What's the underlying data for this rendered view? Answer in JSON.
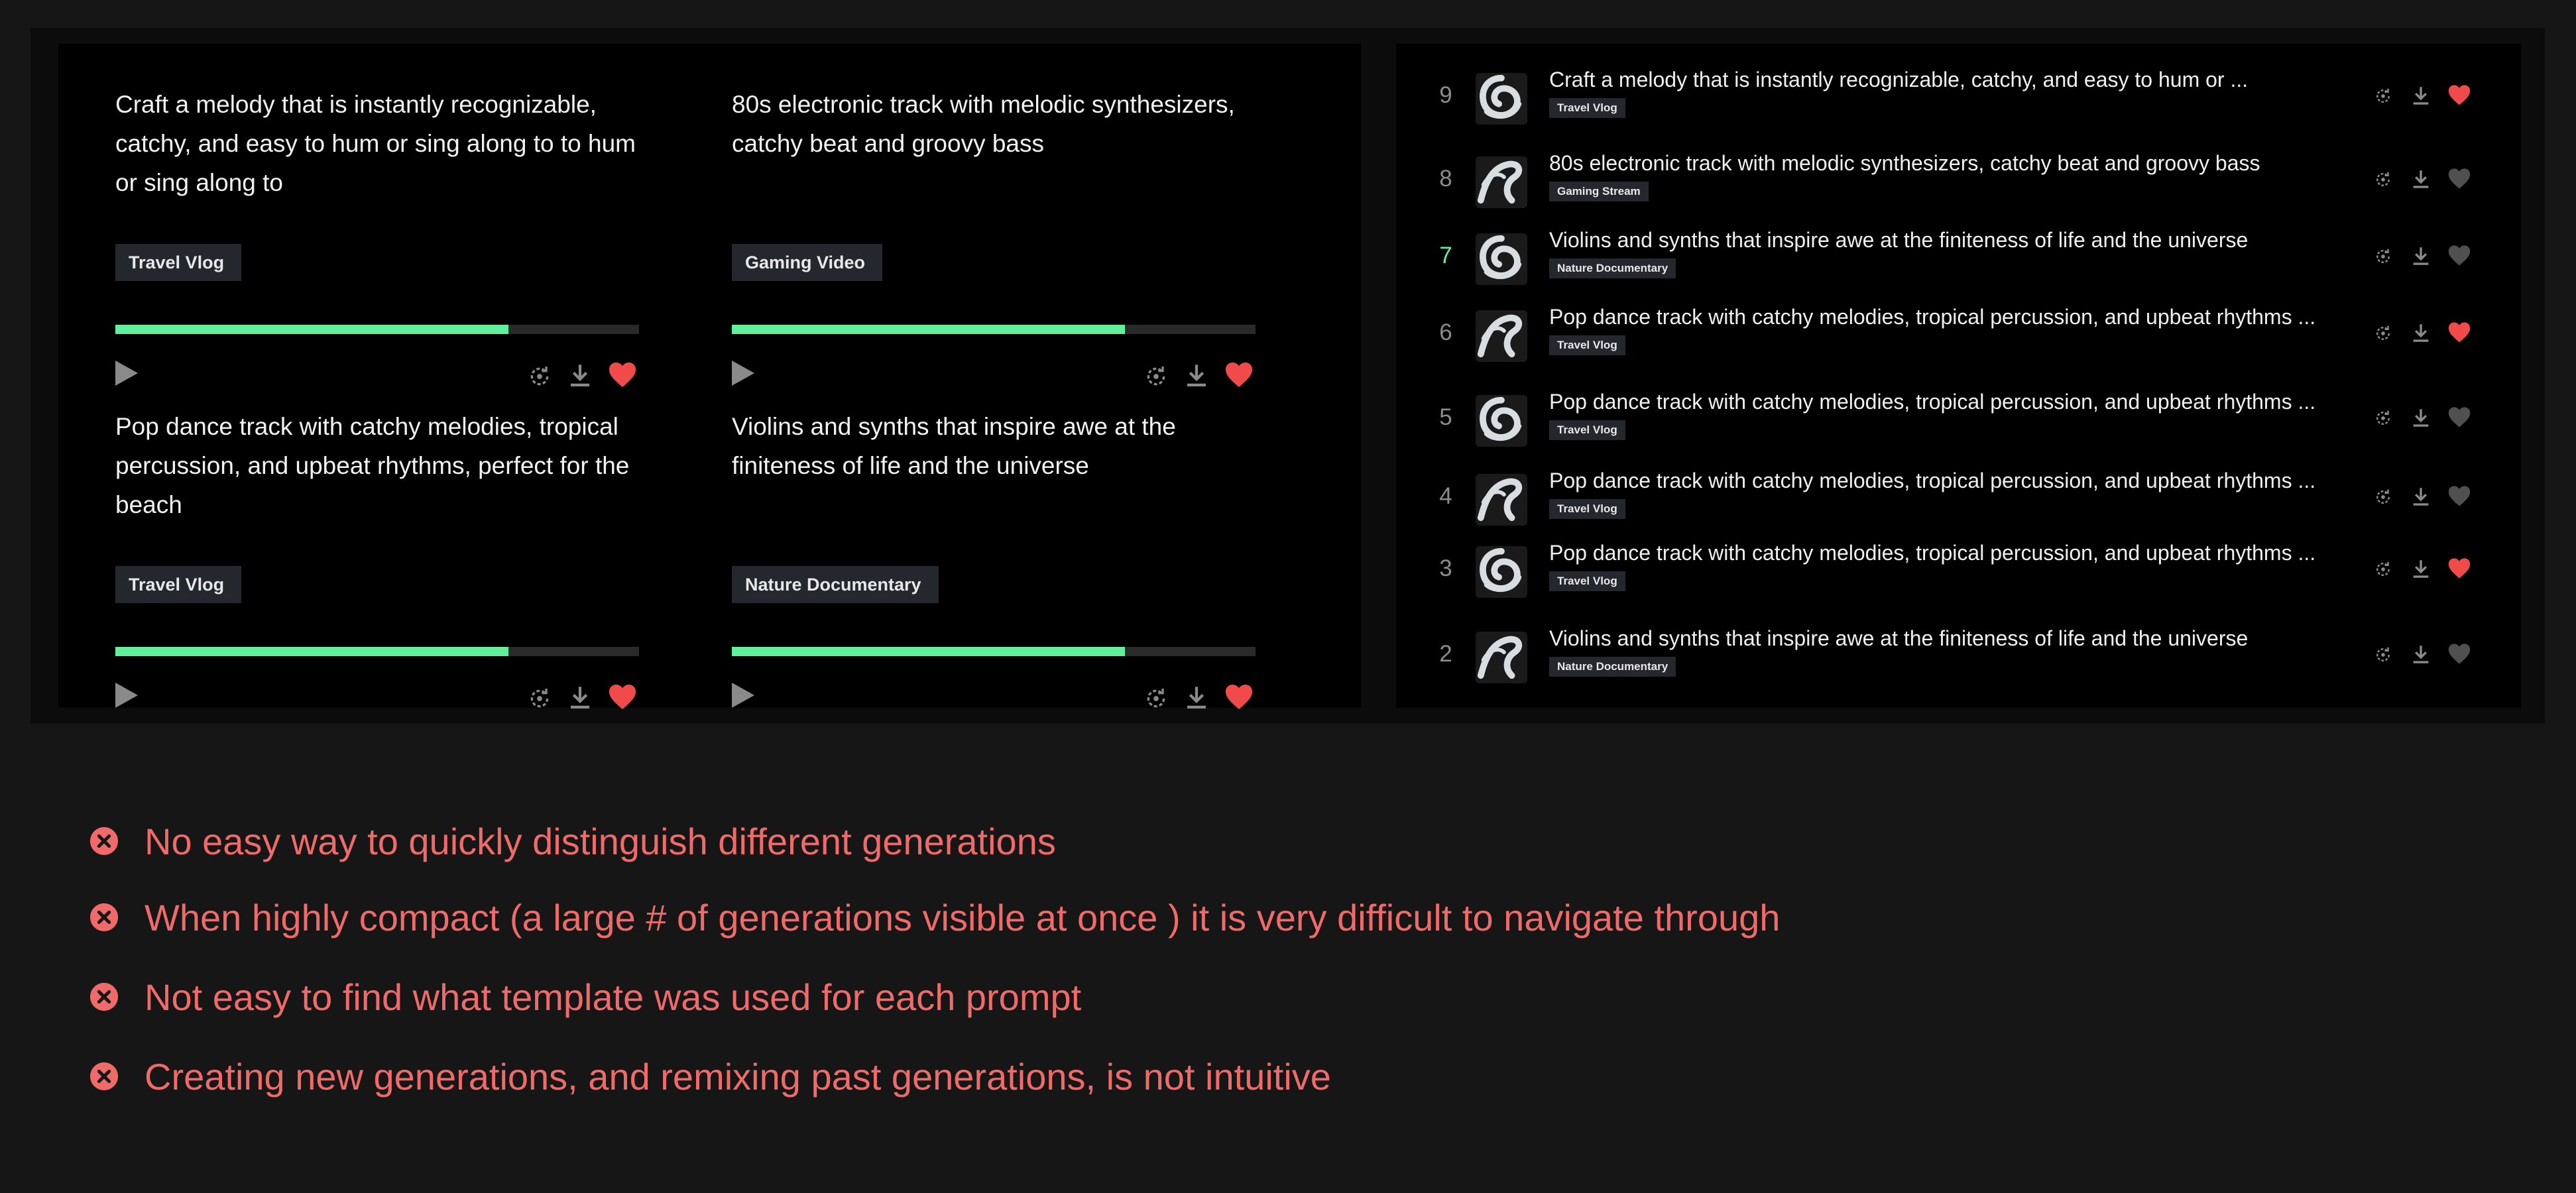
{
  "colors": {
    "accent_green": "#5ef09a",
    "heart_active": "#f04a4a",
    "heart_inactive": "#505050",
    "issue_red": "#f06a6a",
    "tag_bg": "#25272e"
  },
  "cards": [
    {
      "title": "Craft a melody that is instantly recognizable, catchy, and easy to hum or sing along to to hum or sing along to",
      "tag": "Travel Vlog",
      "progress": 0.75,
      "liked": true
    },
    {
      "title": "80s electronic track with melodic synthesizers, catchy beat and groovy bass",
      "tag": "Gaming Video",
      "progress": 0.75,
      "liked": true
    },
    {
      "title": "Pop dance track with catchy melodies, tropical percussion, and upbeat rhythms, perfect for the beach",
      "tag": "Travel Vlog",
      "progress": 0.75,
      "liked": true
    },
    {
      "title": "Violins and synths that inspire awe at the finiteness of life and the universe",
      "tag": "Nature Documentary",
      "progress": 0.75,
      "liked": true
    }
  ],
  "list": [
    {
      "num": "9",
      "title": "Craft a melody that is instantly recognizable, catchy, and easy to hum or ...",
      "tag": "Travel Vlog",
      "liked": true,
      "active": false,
      "art": "swirl"
    },
    {
      "num": "8",
      "title": "80s electronic track with melodic synthesizers, catchy beat and groovy bass",
      "tag": "Gaming Stream",
      "liked": false,
      "active": false,
      "art": "wave"
    },
    {
      "num": "7",
      "title": "Violins and synths that inspire awe at the finiteness of life and the universe",
      "tag": "Nature Documentary",
      "liked": false,
      "active": true,
      "art": "swirl"
    },
    {
      "num": "6",
      "title": "Pop dance track with catchy melodies, tropical percussion, and upbeat rhythms ...",
      "tag": "Travel Vlog",
      "liked": true,
      "active": false,
      "art": "wave"
    },
    {
      "num": "5",
      "title": "Pop dance track with catchy melodies, tropical percussion, and upbeat rhythms ...",
      "tag": "Travel Vlog",
      "liked": false,
      "active": false,
      "art": "swirl"
    },
    {
      "num": "4",
      "title": "Pop dance track with catchy melodies, tropical percussion, and upbeat rhythms ...",
      "tag": "Travel Vlog",
      "liked": false,
      "active": false,
      "art": "wave"
    },
    {
      "num": "3",
      "title": "Pop dance track with catchy melodies, tropical percussion, and upbeat rhythms ...",
      "tag": "Travel Vlog",
      "liked": true,
      "active": false,
      "art": "swirl"
    },
    {
      "num": "2",
      "title": "Violins and synths that inspire awe at the finiteness of life and the universe",
      "tag": "Nature Documentary",
      "liked": false,
      "active": false,
      "art": "wave"
    }
  ],
  "issues": [
    "No easy way to quickly distinguish different generations",
    "When highly compact (a large # of generations visible at once ) it is very difficult to navigate through",
    "Not easy to find what template was used for each prompt",
    "Creating new generations, and remixing past generations, is not intuitive"
  ]
}
